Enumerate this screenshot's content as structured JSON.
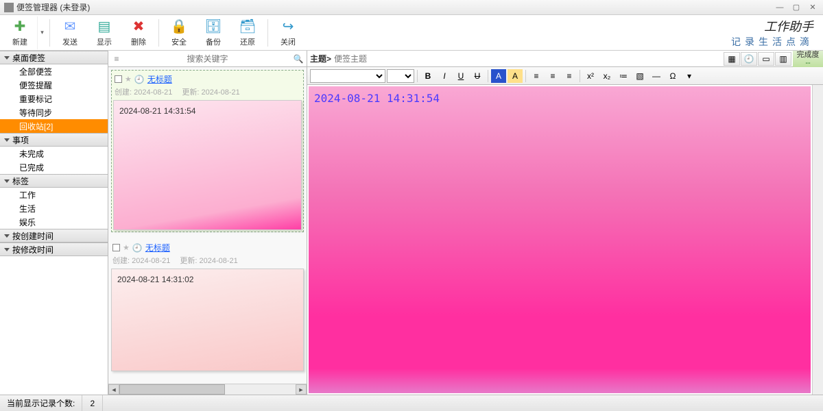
{
  "window": {
    "title": "便签管理器 (未登录)"
  },
  "brand": {
    "line1": "工作助手",
    "line2": "记录生活点滴"
  },
  "toolbar": {
    "new": "新建",
    "send": "发送",
    "show": "显示",
    "delete": "删除",
    "safe": "安全",
    "backup": "备份",
    "restore": "还原",
    "close": "关闭"
  },
  "sidebar": {
    "groups": [
      {
        "label": "桌面便签",
        "items": [
          {
            "label": "全部便签"
          },
          {
            "label": "便签提醒"
          },
          {
            "label": "重要标记"
          },
          {
            "label": "等待同步"
          },
          {
            "label": "回收站[2]",
            "selected": true
          }
        ]
      },
      {
        "label": "事项",
        "items": [
          {
            "label": "未完成"
          },
          {
            "label": "已完成"
          }
        ]
      },
      {
        "label": "标签",
        "items": [
          {
            "label": "工作"
          },
          {
            "label": "生活"
          },
          {
            "label": "娱乐"
          }
        ]
      },
      {
        "label": "按创建时间",
        "items": []
      },
      {
        "label": "按修改时间",
        "items": []
      }
    ]
  },
  "search": {
    "placeholder": "搜索关键字"
  },
  "notes": [
    {
      "title": "无标题",
      "created_lbl": "创建:",
      "created": "2024-08-21",
      "updated_lbl": "更新:",
      "updated": "2024-08-21",
      "body": "2024-08-21 14:31:54",
      "selected": true,
      "style": "pink"
    },
    {
      "title": "无标题",
      "created_lbl": "创建:",
      "created": "2024-08-21",
      "updated_lbl": "更新:",
      "updated": "2024-08-21",
      "body": "2024-08-21 14:31:02",
      "selected": false,
      "style": "pink2"
    }
  ],
  "editor": {
    "subject_label": "主题>",
    "subject_placeholder": "便签主题",
    "completion_label": "完成度",
    "canvas_text": "2024-08-21 14:31:54"
  },
  "status": {
    "label": "当前显示记录个数:",
    "count": "2"
  }
}
